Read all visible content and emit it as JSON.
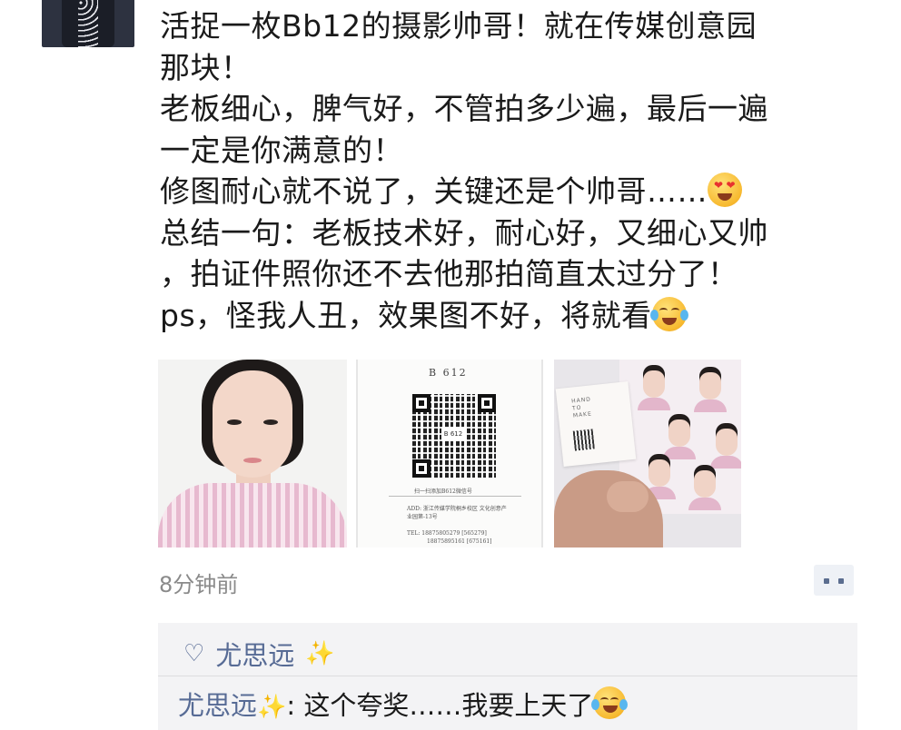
{
  "post": {
    "text_lines": [
      "活捉一枚Bb12的摄影帅哥！就在传媒创意园",
      "那块！",
      "老板细心，脾气好，不管拍多少遍，最后一遍",
      "一定是你满意的！",
      "修图耐心就不说了，关键还是个帅哥……",
      "总结一句：老板技术好，耐心好，又细心又帅",
      "，拍证件照你还不去他那拍简直太过分了！",
      "ps，怪我人丑，效果图不好，将就看"
    ],
    "emojis": [
      "heart-eyes-emoji",
      "tears-of-joy-emoji"
    ]
  },
  "photos": {
    "card_logo": "B 612",
    "card_qr_center": "B 612",
    "card_tagline": "扫一扫添加B612微信号",
    "card_address": "ADD: 浙江传媒学院桐乡校区 文化创意产业园第-13号",
    "card_tel_1": "TEL: 18875805279  [565279]",
    "card_tel_2": "18875895161  [675161]",
    "sheet_card_text": "HAND\nTO\nMAKE"
  },
  "meta": {
    "timestamp": "8分钟前"
  },
  "interactions": {
    "likes": [
      "尤思远"
    ],
    "comments": [
      {
        "author": "尤思远",
        "text": "这个夸奖……我要上天了"
      }
    ],
    "colors": {
      "link": "#576b95",
      "background": "#f3f3f5"
    }
  },
  "icons": [
    "avatar",
    "heart-icon",
    "sparkles-icon",
    "comment-icon"
  ]
}
